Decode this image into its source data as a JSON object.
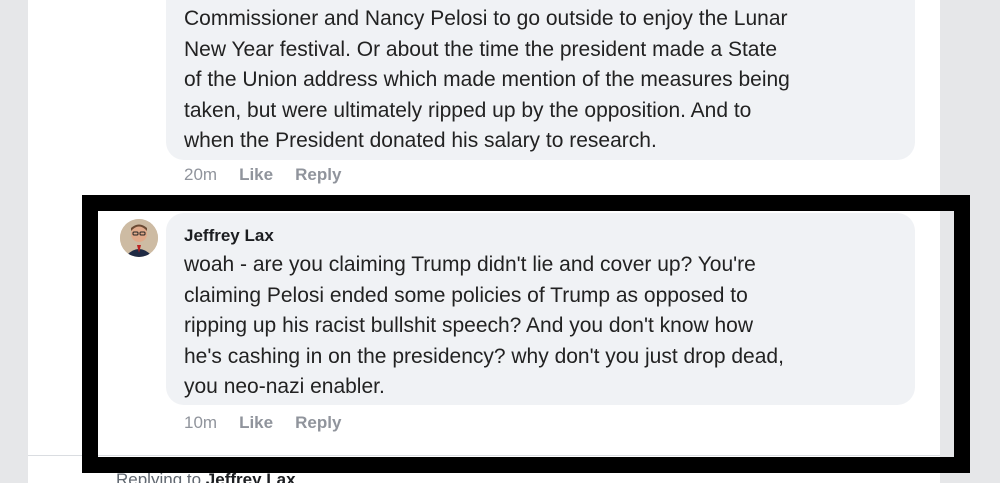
{
  "previous_comment": {
    "text": "Commissioner and Nancy Pelosi to go outside to enjoy the Lunar\nNew Year festival. Or about the time the president made a State\nof the Union address which made mention of the measures being\ntaken, but were ultimately ripped up by the opposition. And to\nwhen the President donated his salary to research.",
    "time": "20m",
    "like_label": "Like",
    "reply_label": "Reply"
  },
  "highlighted_comment": {
    "author": "Jeffrey Lax",
    "text": "woah - are you claiming Trump didn't lie and cover up?  You're\nclaiming Pelosi ended some policies of Trump as opposed to\nripping up his racist bullshit speech?  And you don't know how\nhe's cashing in on the presidency?  why don't you just drop dead,\nyou neo-nazi enabler.",
    "time": "10m",
    "like_label": "Like",
    "reply_label": "Reply"
  },
  "reply_hint": {
    "prefix": "Replying to",
    "name": "Jeffrey Lax"
  },
  "colors": {
    "highlight_border": "#000000",
    "bubble_bg": "#f0f2f5",
    "page_bg": "#e6e7e9"
  }
}
